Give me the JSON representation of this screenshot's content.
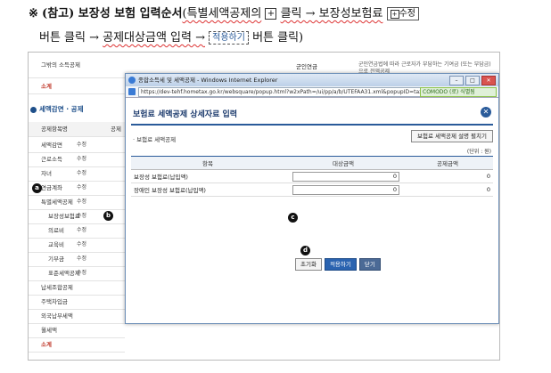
{
  "doc": {
    "mark": "※",
    "heading": "(참고) 보장성 보험 입력순서",
    "line1_a": "(특별세액공제의",
    "plus_symbol": "+",
    "line1_b": "클릭 → 보장성보험료",
    "edit_label": "수정",
    "line2_a": "버튼 클릭 →",
    "line2_b": "공제대상금액 입력 →",
    "apply_label": "적용하기",
    "line2_c": "버튼 클릭)"
  },
  "background": {
    "top_row_label": "그밖의 소득공제",
    "subtotal": "소계",
    "section_title": "세액감면 · 공제",
    "col_header1": "공제항목명",
    "col_header2": "공제",
    "right_header": "군인연금",
    "right_note": "군인연금법에 따라 근로자가 부담하는 기여금 (또는 부담금)으로 전액공제",
    "edit": "수정",
    "rows": [
      "세액감면",
      "근로소득",
      "자녀",
      "연금계좌",
      "특별세액공제",
      "보장성보험료",
      "의료비",
      "교육비",
      "기부금",
      "표준세액공제",
      "납세조합공제",
      "주택차입금",
      "외국납부세액",
      "월세액",
      "소계"
    ]
  },
  "popup": {
    "window_title": "종합소득세 및 세액공제 - Windows Internet Explorer",
    "url": "https://dev-tehf.hometax.go.kr/websquare/popup.html?w2xPath=/ui/pp/a/b/UTEFAA31.xml&popupID=taxPhPop",
    "cert": "COMODO (로) 식별됨",
    "title": "보험료 세액공제 상세자료 입력",
    "sub_title": "· 보험료 세액공제",
    "guide_button": "보험료 세액공제 설명 펼치기",
    "unit": "(단위 : 원)",
    "headers": [
      "항목",
      "대상금액",
      "공제금액"
    ],
    "rows": [
      {
        "item": "보장성 보험료(납입액)",
        "target": "0",
        "deduct": "0"
      },
      {
        "item": "장애인 보장성 보험료(납입액)",
        "target": "0",
        "deduct": "0"
      }
    ],
    "buttons": {
      "reset": "초기화",
      "apply": "적용하기",
      "close": "닫기"
    }
  },
  "markers": {
    "a": "a",
    "b": "b",
    "c": "c",
    "d": "d"
  }
}
